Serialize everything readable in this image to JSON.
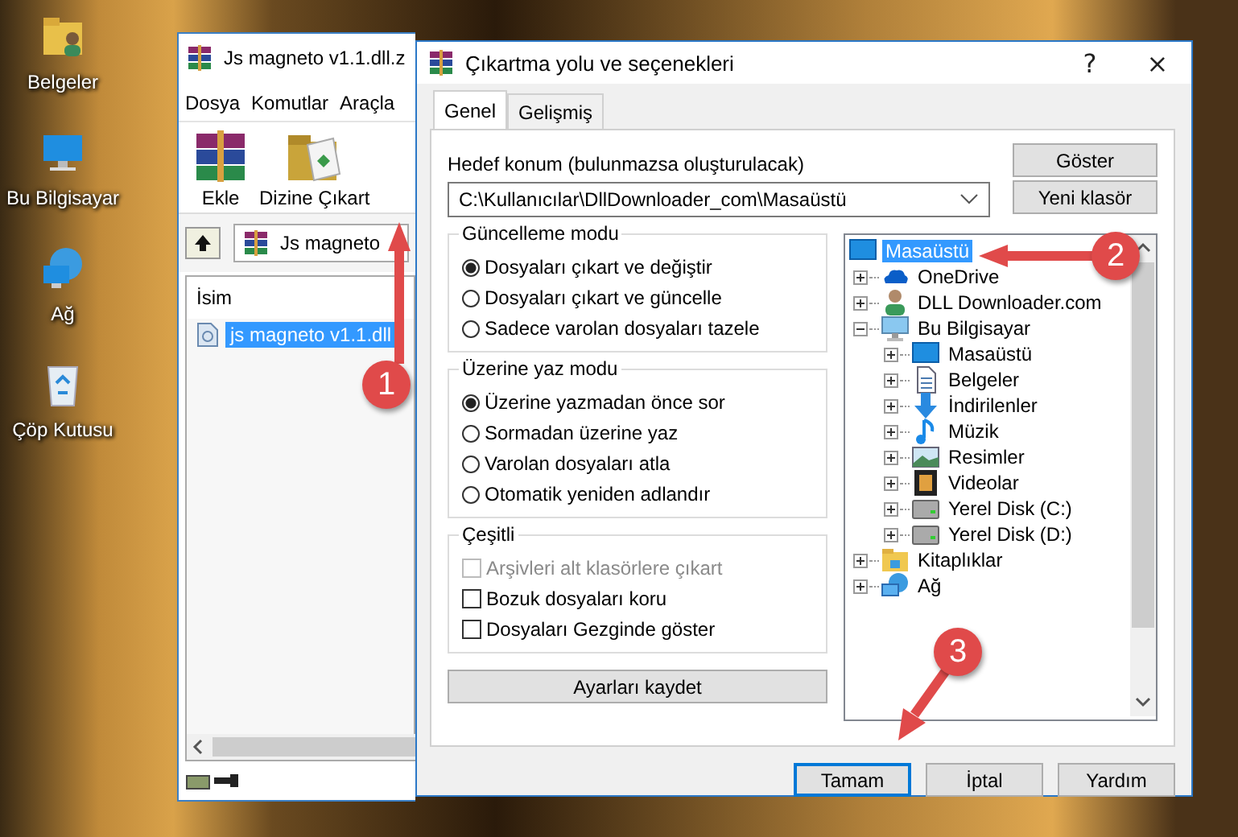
{
  "desktop": {
    "icons": [
      {
        "label": "Belgeler",
        "kind": "documents"
      },
      {
        "label": "Bu Bilgisayar",
        "kind": "computer"
      },
      {
        "label": "Ağ",
        "kind": "network"
      },
      {
        "label": "Çöp Kutusu",
        "kind": "recycle"
      }
    ]
  },
  "archiver_window": {
    "title": "Js magneto v1.1.dll.z",
    "menu": [
      "Dosya",
      "Komutlar",
      "Araçla"
    ],
    "toolbar": [
      {
        "label": "Ekle",
        "kind": "add"
      },
      {
        "label": "Dizine Çıkart",
        "kind": "extract"
      }
    ],
    "address": "Js magneto",
    "list": {
      "columns": [
        "İsim"
      ],
      "rows": [
        {
          "name": "js magneto v1.1.dll",
          "selected": true
        }
      ]
    }
  },
  "dialog": {
    "title": "Çıkartma yolu ve seçenekleri",
    "title_buttons": [
      "?",
      "×"
    ],
    "tabs": [
      {
        "label": "Genel",
        "selected": true
      },
      {
        "label": "Gelişmiş",
        "selected": false
      }
    ],
    "destination_label": "Hedef konum (bulunmazsa oluşturulacak)",
    "destination_value": "C:\\Kullanıcılar\\DllDownloader_com\\Masaüstü",
    "side_buttons": [
      "Göster",
      "Yeni klasör"
    ],
    "groups": [
      {
        "title": "Güncelleme modu",
        "kind": "radio",
        "options": [
          {
            "label": "Dosyaları çıkart ve değiştir",
            "selected": true
          },
          {
            "label": "Dosyaları çıkart ve güncelle",
            "selected": false
          },
          {
            "label": "Sadece varolan dosyaları tazele",
            "selected": false
          }
        ]
      },
      {
        "title": "Üzerine yaz modu",
        "kind": "radio",
        "options": [
          {
            "label": "Üzerine yazmadan önce sor",
            "selected": true
          },
          {
            "label": "Sormadan üzerine yaz",
            "selected": false
          },
          {
            "label": "Varolan dosyaları atla",
            "selected": false
          },
          {
            "label": "Otomatik yeniden adlandır",
            "selected": false
          }
        ]
      },
      {
        "title": "Çeşitli",
        "kind": "checkbox",
        "options": [
          {
            "label": "Arşivleri alt klasörlere çıkart",
            "checked": false,
            "disabled": true
          },
          {
            "label": "Bozuk dosyaları koru",
            "checked": false,
            "disabled": false
          },
          {
            "label": "Dosyaları Gezginde göster",
            "checked": false,
            "disabled": false
          }
        ]
      }
    ],
    "save_button": "Ayarları kaydet",
    "tree": [
      {
        "label": "Masaüstü",
        "kind": "desktop",
        "selected": true,
        "children": [
          {
            "label": "OneDrive",
            "kind": "cloud",
            "selected": false,
            "expanded": false
          },
          {
            "label": "DLL Downloader.com",
            "kind": "user",
            "selected": false,
            "expanded": false
          },
          {
            "label": "Bu Bilgisayar",
            "kind": "computer",
            "selected": false,
            "expanded": true,
            "children": [
              {
                "label": "Masaüstü",
                "kind": "desktop",
                "selected": false,
                "expanded": false
              },
              {
                "label": "Belgeler",
                "kind": "document",
                "selected": false,
                "expanded": false
              },
              {
                "label": "İndirilenler",
                "kind": "download",
                "selected": false,
                "expanded": false
              },
              {
                "label": "Müzik",
                "kind": "music",
                "selected": false,
                "expanded": false
              },
              {
                "label": "Resimler",
                "kind": "picture",
                "selected": false,
                "expanded": false
              },
              {
                "label": "Videolar",
                "kind": "video",
                "selected": false,
                "expanded": false
              },
              {
                "label": "Yerel Disk (C:)",
                "kind": "drive",
                "selected": false,
                "expanded": false
              },
              {
                "label": "Yerel Disk (D:)",
                "kind": "drive",
                "selected": false,
                "expanded": false
              }
            ]
          },
          {
            "label": "Kitaplıklar",
            "kind": "folder",
            "selected": false,
            "expanded": false
          },
          {
            "label": "Ağ",
            "kind": "network",
            "selected": false,
            "expanded": false
          }
        ]
      }
    ],
    "buttons": [
      {
        "label": "Tamam",
        "default": true
      },
      {
        "label": "İptal",
        "default": false
      },
      {
        "label": "Yardım",
        "default": false
      }
    ]
  },
  "annotations": [
    {
      "number": "1"
    },
    {
      "number": "2"
    },
    {
      "number": "3"
    }
  ]
}
